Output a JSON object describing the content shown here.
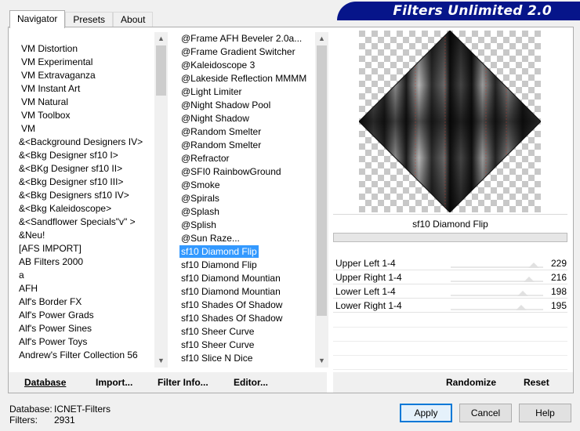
{
  "tabs": [
    "Navigator",
    "Presets",
    "About"
  ],
  "banner": {
    "title": "Filters Unlimited 2.0",
    "bg_color": "#06158a"
  },
  "categories": [
    "VM Distortion",
    "VM Experimental",
    "VM Extravaganza",
    "VM Instant Art",
    "VM Natural",
    "VM Toolbox",
    "VM",
    "&<Background Designers IV>",
    "&<Bkg Designer sf10 I>",
    "&<BKg Designer sf10 II>",
    "&<Bkg Designer sf10 III>",
    "&<Bkg Designers sf10 IV>",
    "&<Bkg Kaleidoscope>",
    "&<Sandflower Specials\"v\" >",
    "&Neu!",
    "[AFS IMPORT]",
    "AB Filters 2000",
    "a",
    "AFH",
    "Alf's Border FX",
    "Alf's Power Grads",
    "Alf's Power Sines",
    "Alf's Power Toys",
    "Andrew's Filter Collection 56"
  ],
  "filters": [
    "@Frame AFH Beveler 2.0a...",
    "@Frame Gradient Switcher",
    "@Kaleidoscope 3",
    "@Lakeside Reflection MMMM",
    "@Light Limiter",
    "@Night Shadow Pool",
    "@Night Shadow",
    "@Random Smelter",
    "@Random Smelter",
    "@Refractor",
    "@SFI0 RainbowGround",
    "@Smoke",
    "@Spirals",
    "@Splash",
    "@Splish",
    "@Sun Raze...",
    "sf10 Diamond Flip",
    "sf10 Diamond Flip",
    "sf10 Diamond Mountian",
    "sf10 Diamond Mountian",
    "sf10 Shades Of Shadow",
    "sf10 Shades Of Shadow",
    "sf10 Sheer Curve",
    "sf10 Sheer Curve",
    "sf10 Slice N Dice"
  ],
  "selected_filter_index": 16,
  "selection_color": "#3399ff",
  "current_filter": "sf10 Diamond Flip",
  "params": [
    {
      "label": "Upper Left 1-4",
      "value": "229",
      "level": 229
    },
    {
      "label": "Upper Right 1-4",
      "value": "216",
      "level": 216
    },
    {
      "label": "Lower Left 1-4",
      "value": "198",
      "level": 198
    },
    {
      "label": "Lower Right 1-4",
      "value": "195",
      "level": 195
    }
  ],
  "buttons": {
    "database": "Database",
    "import": "Import...",
    "filter_info": "Filter Info...",
    "editor": "Editor...",
    "randomize": "Randomize",
    "reset": "Reset",
    "apply": "Apply",
    "cancel": "Cancel",
    "help": "Help"
  },
  "status": {
    "database_label": "Database:",
    "database_value": "ICNET-Filters",
    "filters_label": "Filters:",
    "filters_value": "2931"
  }
}
